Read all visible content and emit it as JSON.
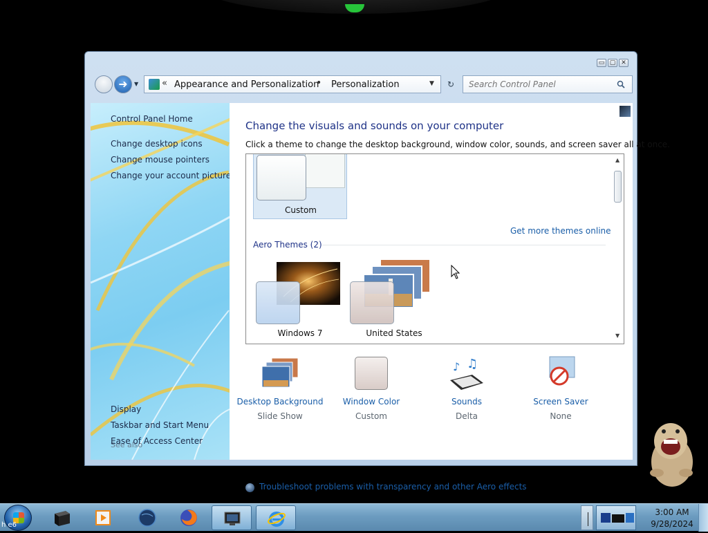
{
  "window": {
    "controls": {
      "minimize": "▭",
      "maximize": "▢",
      "close": "✕"
    },
    "nav": {
      "back_icon": "back-arrow-icon",
      "forward_icon": "forward-arrow-icon",
      "forward_glyph": "➜"
    },
    "breadcrumb": {
      "chevron": "«",
      "items": [
        "Appearance and Personalization",
        "Personalization"
      ],
      "separator": "•"
    },
    "search": {
      "placeholder": "Search Control Panel",
      "value": ""
    }
  },
  "left_pane": {
    "links": [
      "Control Panel Home",
      "Change desktop icons",
      "Change mouse pointers",
      "Change your account picture"
    ],
    "see_also": {
      "label": "See also",
      "links": [
        "Display",
        "Taskbar and Start Menu",
        "Ease of Access Center"
      ]
    }
  },
  "main": {
    "title": "Change the visuals and sounds on your computer",
    "description": "Click a theme to change the desktop background, window color, sounds, and screen saver all at once.",
    "themes": {
      "my_themes": [
        {
          "name": "Custom",
          "selected": true
        }
      ],
      "get_more_link": "Get more themes online",
      "aero_header": "Aero Themes (2)",
      "aero_themes": [
        {
          "name": "Windows 7"
        },
        {
          "name": "United States"
        }
      ]
    },
    "settings": [
      {
        "label": "Desktop Background",
        "value": "Slide Show",
        "icon": "desktop-background-icon"
      },
      {
        "label": "Window Color",
        "value": "Custom",
        "icon": "window-color-icon"
      },
      {
        "label": "Sounds",
        "value": "Delta",
        "icon": "sounds-icon"
      },
      {
        "label": "Screen Saver",
        "value": "None",
        "icon": "screen-saver-icon"
      }
    ],
    "troubleshoot_link": "Troubleshoot problems with transparency and other Aero effects"
  },
  "taskbar": {
    "start_label": "h e6",
    "pinned": [
      {
        "icon": "black-box-app-icon"
      },
      {
        "icon": "media-player-icon"
      },
      {
        "icon": "globe-app-icon"
      },
      {
        "icon": "firefox-icon"
      },
      {
        "icon": "control-panel-window-icon",
        "active": true
      },
      {
        "icon": "internet-explorer-icon",
        "active": true
      }
    ],
    "clock": {
      "time": "3:00 AM",
      "date": "9/28/2024"
    }
  },
  "colors": {
    "title_blue": "#1e3287",
    "link_blue": "#1a5ea8",
    "taskbar": "#6c9cc0",
    "accent_green": "#27c43a"
  }
}
